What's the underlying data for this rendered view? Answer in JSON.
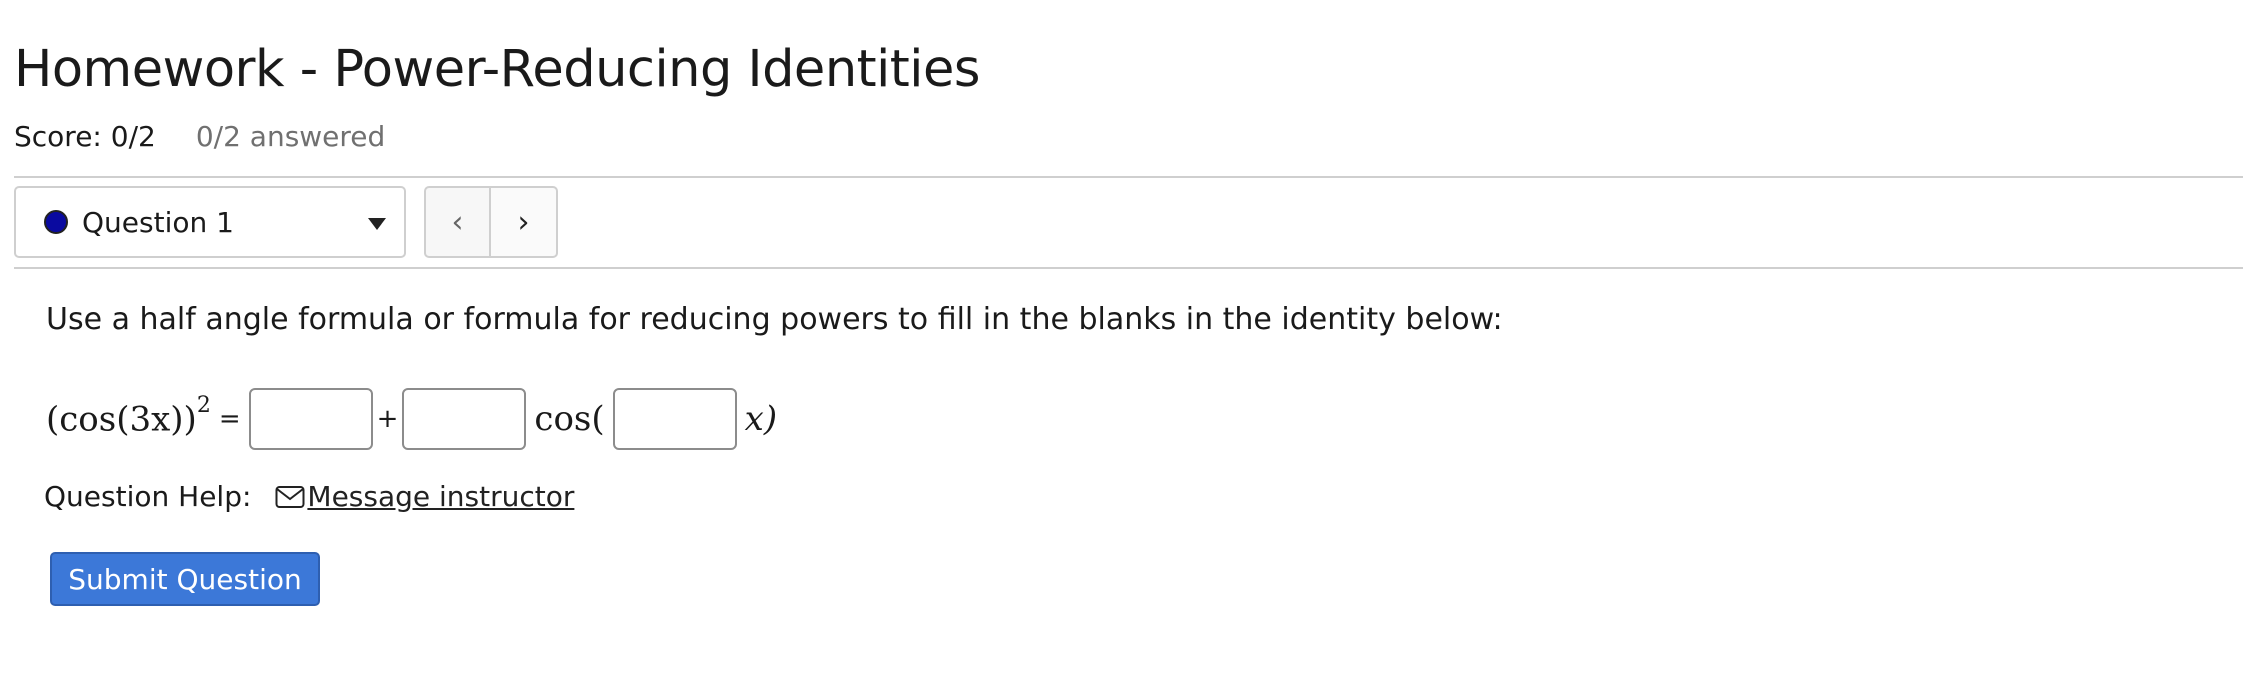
{
  "header": {
    "title": "Homework - Power-Reducing Identities",
    "score": "Score: 0/2",
    "answered": "0/2 answered"
  },
  "question_nav": {
    "selected": "Question 1",
    "prev_glyph": "‹",
    "next_glyph": "›"
  },
  "question": {
    "prompt": "Use a half angle formula or formula for reducing powers to fill in the blanks in the identity below:",
    "lhs": "(cos(3x))",
    "lhs_exponent": "2",
    "equals": "=",
    "plus": "+",
    "cos_open": "cos(",
    "x_close": "x)",
    "blanks": [
      "",
      "",
      ""
    ]
  },
  "help": {
    "label": "Question Help:",
    "message_link": "Message instructor"
  },
  "actions": {
    "submit_label": "Submit Question"
  },
  "colors": {
    "accent": "#3c78d8",
    "question_dot": "#0a0aa0",
    "muted_text": "#707070",
    "divider": "#cfcfcf"
  }
}
